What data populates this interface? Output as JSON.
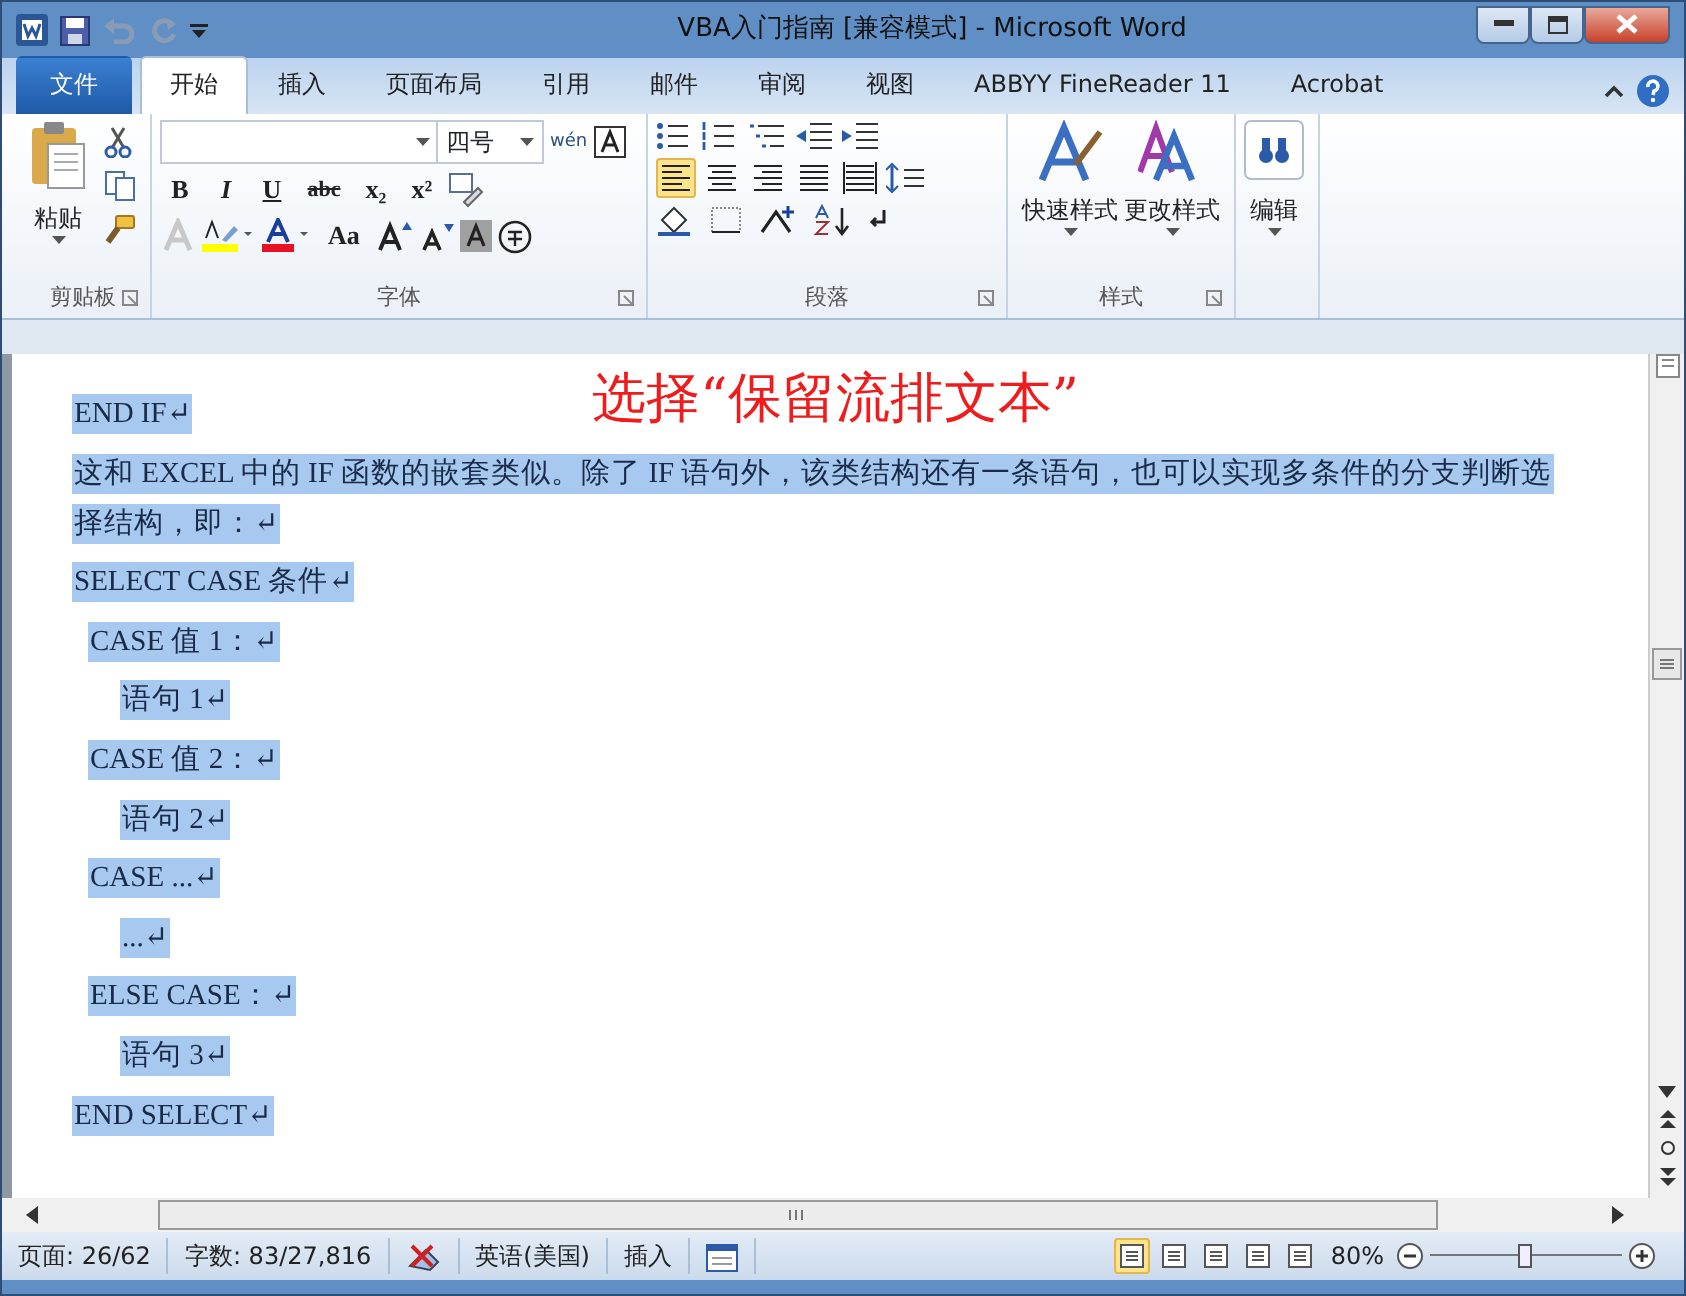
{
  "window": {
    "title": "VBA入门指南 [兼容模式] - Microsoft Word"
  },
  "tabs": [
    {
      "label": "文件",
      "kind": "file",
      "selected": false
    },
    {
      "label": "开始",
      "kind": "tab",
      "selected": true
    },
    {
      "label": "插入",
      "kind": "tab",
      "selected": false
    },
    {
      "label": "页面布局",
      "kind": "tab",
      "selected": false
    },
    {
      "label": "引用",
      "kind": "tab",
      "selected": false
    },
    {
      "label": "邮件",
      "kind": "tab",
      "selected": false
    },
    {
      "label": "审阅",
      "kind": "tab",
      "selected": false
    },
    {
      "label": "视图",
      "kind": "tab",
      "selected": false
    },
    {
      "label": "ABBYY FineReader 11",
      "kind": "tab",
      "selected": false
    },
    {
      "label": "Acrobat",
      "kind": "tab",
      "selected": false
    }
  ],
  "ribbon": {
    "clipboard": {
      "label": "剪贴板",
      "paste": "粘贴"
    },
    "font": {
      "label": "字体",
      "font_size": "四号",
      "phonetic": "wén",
      "format_buttons": [
        "B",
        "I",
        "U",
        "abc",
        "x₂",
        "x²"
      ],
      "case_button": "Aa"
    },
    "paragraph": {
      "label": "段落",
      "alignments": [
        {
          "selected": true
        },
        {
          "selected": false
        },
        {
          "selected": false
        },
        {
          "selected": false
        },
        {
          "selected": false
        }
      ]
    },
    "styles": {
      "label": "样式",
      "buttons": [
        "快速样式",
        "更改样式"
      ]
    },
    "editing": {
      "label": "编辑"
    }
  },
  "annotation": "选择“保留流排文本”",
  "document": {
    "paragraphs": [
      {
        "kind": "top",
        "text": "END IF↵",
        "selected": true
      },
      {
        "kind": "prose",
        "text": "这和 EXCEL 中的 IF 函数的嵌套类似。除了 IF 语句外，该类结构还有一条语句，也可以实现多条件的分支判断选",
        "selected": true
      },
      {
        "kind": "prose-end",
        "text": "择结构，即：↵",
        "selected": true
      },
      {
        "kind": "top",
        "text": "SELECT CASE  条件↵",
        "selected": true
      },
      {
        "kind": "case",
        "text": "CASE  值 1：↵",
        "selected": true
      },
      {
        "kind": "statement",
        "text": "语句 1↵",
        "selected": true
      },
      {
        "kind": "case",
        "text": "CASE  值 2：↵",
        "selected": true
      },
      {
        "kind": "statement",
        "text": "语句 2↵",
        "selected": true
      },
      {
        "kind": "case",
        "text": "CASE ...↵",
        "selected": true
      },
      {
        "kind": "statement",
        "text": "...↵",
        "selected": true
      },
      {
        "kind": "case",
        "text": "ELSE CASE：↵",
        "selected": true
      },
      {
        "kind": "statement",
        "text": "语句 3↵",
        "selected": true
      },
      {
        "kind": "top",
        "text": "END SELECT↵",
        "selected": true
      }
    ]
  },
  "status_bar": {
    "page": "页面: 26/62",
    "words": "字数: 83/27,816",
    "language": "英语(美国)",
    "mode": "插入",
    "views": [
      {
        "selected": true
      },
      {
        "selected": false
      },
      {
        "selected": false
      },
      {
        "selected": false
      },
      {
        "selected": false
      }
    ],
    "zoom": "80%",
    "zoom_slider": {
      "level": 0.5
    }
  }
}
